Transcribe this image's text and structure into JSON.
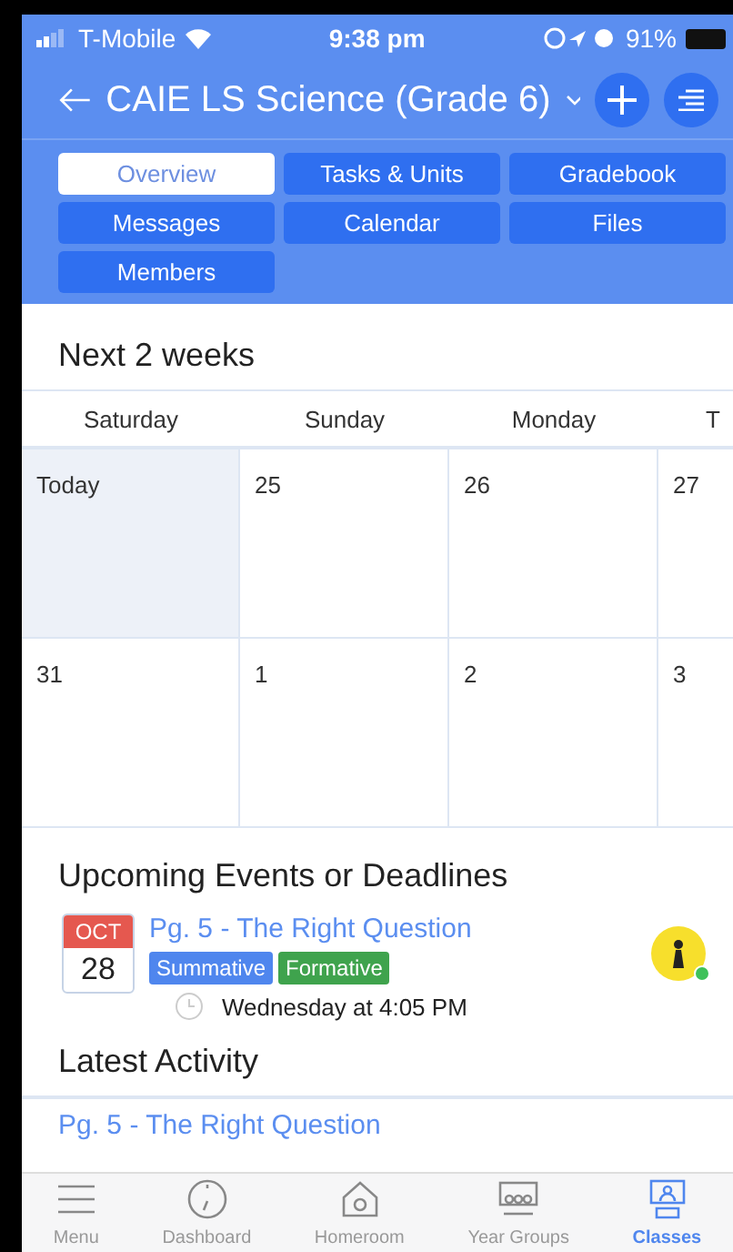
{
  "status_bar": {
    "carrier": "T-Mobile",
    "time": "9:38 pm",
    "battery": "91%"
  },
  "header": {
    "title": "CAIE LS Science (Grade 6)"
  },
  "tabs": [
    {
      "label": "Overview",
      "selected": true
    },
    {
      "label": "Tasks & Units",
      "selected": false
    },
    {
      "label": "Gradebook",
      "selected": false
    },
    {
      "label": "Messages",
      "selected": false
    },
    {
      "label": "Calendar",
      "selected": false
    },
    {
      "label": "Files",
      "selected": false
    },
    {
      "label": "Members",
      "selected": false
    }
  ],
  "calendar": {
    "title": "Next 2 weeks",
    "weekdays": [
      "Saturday",
      "Sunday",
      "Monday",
      "T"
    ],
    "weeks": [
      [
        {
          "label": "Today",
          "today": true
        },
        {
          "label": "25",
          "today": false
        },
        {
          "label": "26",
          "today": false
        },
        {
          "label": "27",
          "today": false
        }
      ],
      [
        {
          "label": "31",
          "today": false
        },
        {
          "label": "1",
          "today": false
        },
        {
          "label": "2",
          "today": false
        },
        {
          "label": "3",
          "today": false
        }
      ]
    ]
  },
  "upcoming": {
    "title": "Upcoming Events or Deadlines",
    "events": [
      {
        "month": "OCT",
        "day": "28",
        "title": "Pg. 5 - The Right Question",
        "tags": [
          {
            "label": "Summative",
            "color": "#4f86ee"
          },
          {
            "label": "Formative",
            "color": "#3fa34d"
          }
        ],
        "time": "Wednesday at 4:05 PM"
      }
    ]
  },
  "activity": {
    "title": "Latest Activity",
    "items": [
      {
        "title": "Pg. 5 - The Right Question"
      }
    ]
  },
  "nav": [
    {
      "label": "Menu",
      "kind": "menu",
      "selected": false
    },
    {
      "label": "Dashboard",
      "kind": "gauge",
      "selected": false
    },
    {
      "label": "Homeroom",
      "kind": "home",
      "selected": false
    },
    {
      "label": "Year Groups",
      "kind": "group",
      "selected": false
    },
    {
      "label": "Classes",
      "kind": "class",
      "selected": true
    }
  ]
}
